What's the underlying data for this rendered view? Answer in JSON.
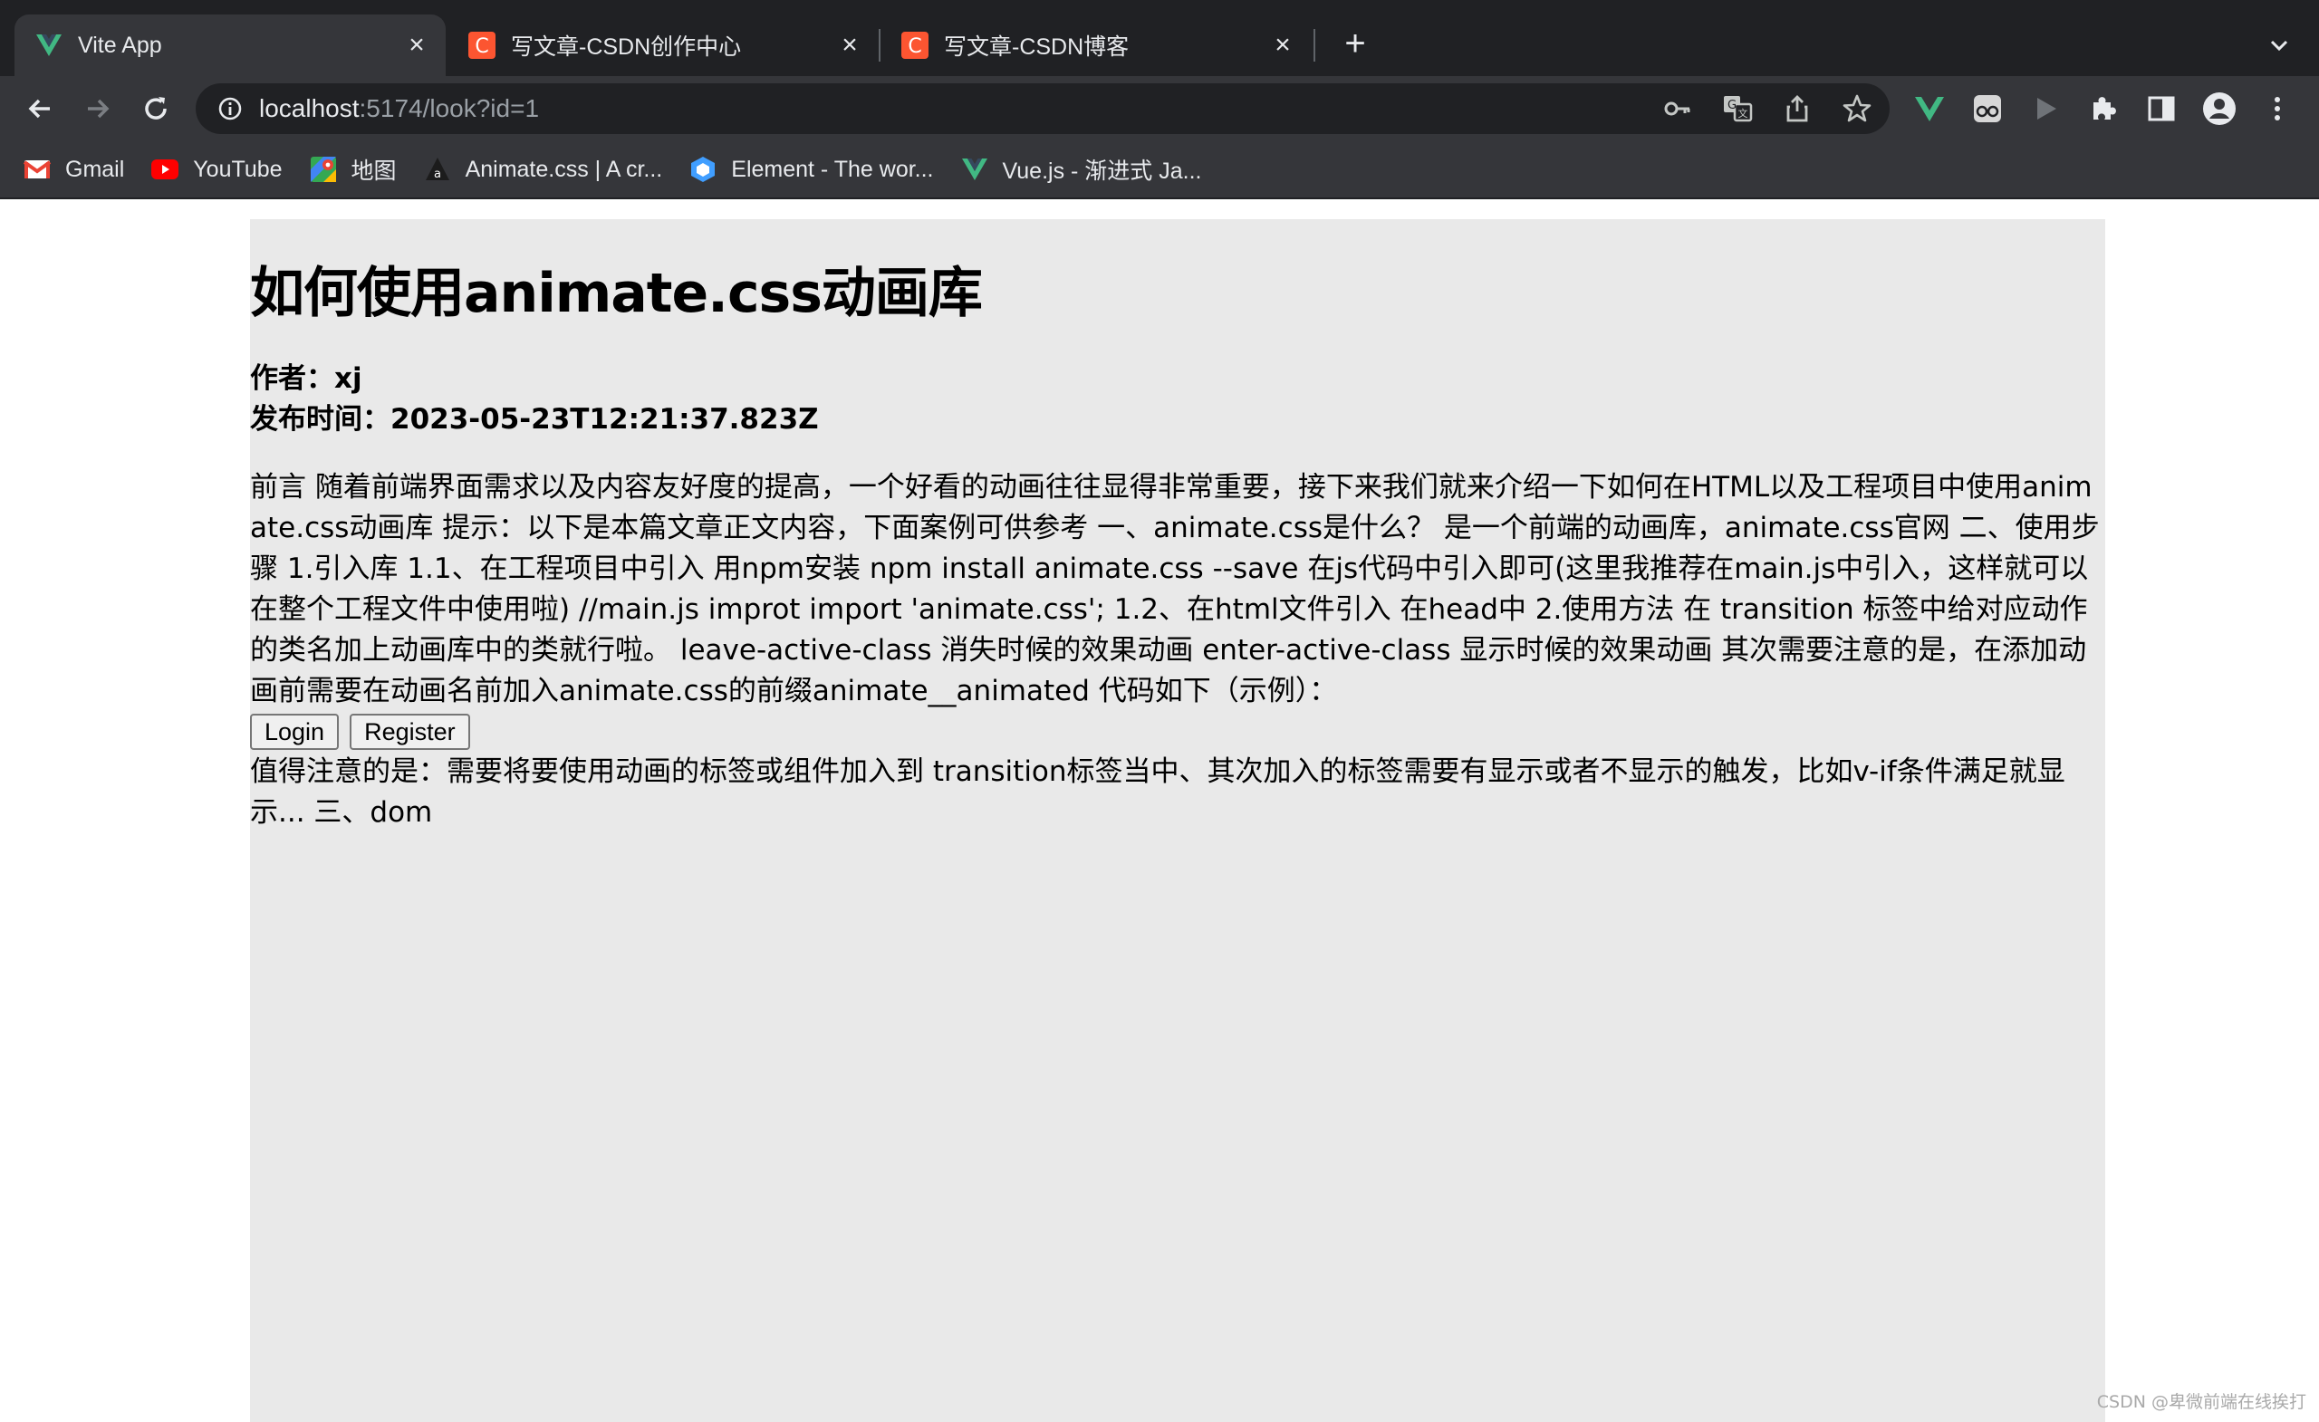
{
  "tabs": [
    {
      "title": "Vite App",
      "active": true,
      "favicon": "vue-v-icon"
    },
    {
      "title": "写文章-CSDN创作中心",
      "active": false,
      "favicon": "csdn-c-icon"
    },
    {
      "title": "写文章-CSDN博客",
      "active": false,
      "favicon": "csdn-c-icon"
    }
  ],
  "address_bar": {
    "host": "localhost",
    "path": ":5174/look?id=1"
  },
  "bookmarks": [
    {
      "label": "Gmail",
      "icon": "gmail-icon"
    },
    {
      "label": "YouTube",
      "icon": "youtube-icon"
    },
    {
      "label": "地图",
      "icon": "maps-icon"
    },
    {
      "label": "Animate.css | A cr...",
      "icon": "animate-icon"
    },
    {
      "label": "Element - The wor...",
      "icon": "element-icon"
    },
    {
      "label": "Vue.js - 渐进式 Ja...",
      "icon": "vue-icon"
    }
  ],
  "article": {
    "title": "如何使用animate.css动画库",
    "author": "作者：xj",
    "published": "发布时间：2023-05-23T12:21:37.823Z",
    "body_before": "前言 随着前端界面需求以及内容友好度的提高，一个好看的动画往往显得非常重要，接下来我们就来介绍一下如何在HTML以及工程项目中使用animate.css动画库 提示：以下是本篇文章正文内容，下面案例可供参考 一、animate.css是什么？ 是一个前端的动画库，animate.css官网 二、使用步骤 1.引入库 1.1、在工程项目中引入 用npm安装 npm install animate.css --save 在js代码中引入即可(这里我推荐在main.js中引入，这样就可以在整个工程文件中使用啦) //main.js improt import 'animate.css'; 1.2、在html文件引入 在head中 2.使用方法 在 transition 标签中给对应动作的类名加上动画库中的类就行啦。 leave-active-class 消失时候的效果动画 enter-active-class 显示时候的效果动画 其次需要注意的是，在添加动画前需要在动画名前加入animate.css的前缀animate__animated 代码如下（示例）：",
    "buttons": {
      "login": "Login",
      "register": "Register"
    },
    "body_after": "值得注意的是：需要将要使用动画的标签或组件加入到 transition标签当中、其次加入的标签需要有显示或者不显示的触发，比如v-if条件满足就显示... 三、dom"
  },
  "watermark": "CSDN @卑微前端在线挨打",
  "colors": {
    "chrome_dark": "#202124",
    "chrome_toolbar": "#35363a",
    "article_bg": "#e9e9e9",
    "vue_green": "#41b883",
    "csdn_red": "#fc5531"
  }
}
